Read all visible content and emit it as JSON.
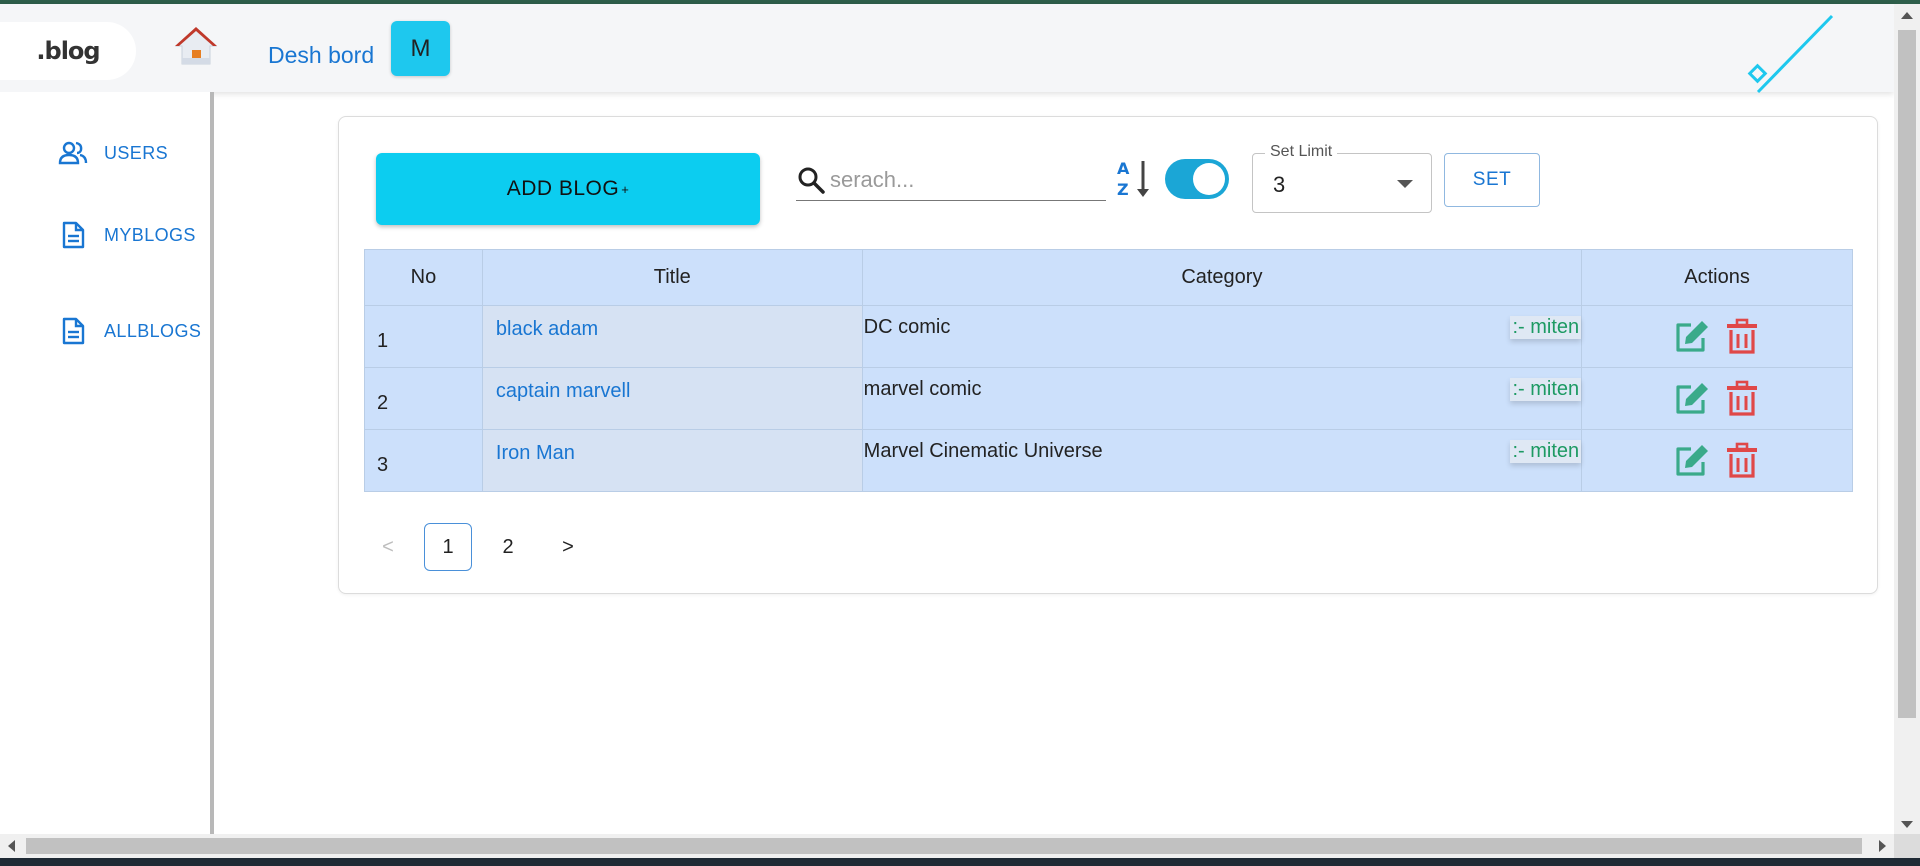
{
  "header": {
    "logo_text": ".blog",
    "dashboard_label": "Desh bord",
    "avatar_initial": "M"
  },
  "sidebar": {
    "items": [
      {
        "label": "USERS",
        "icon": "users-icon"
      },
      {
        "label": "MYBLOGS",
        "icon": "document-icon"
      },
      {
        "label": "ALLBLOGS",
        "icon": "document-icon"
      }
    ]
  },
  "toolbar": {
    "add_label": "ADD BLOG",
    "add_sup": "+",
    "search_placeholder": "serach...",
    "sort_icon": "sort-az-icon",
    "toggle_on": true,
    "limit_label": "Set Limit",
    "limit_value": "3",
    "set_label": "SET"
  },
  "table": {
    "headers": [
      "No",
      "Title",
      "Category",
      "Actions"
    ],
    "rows": [
      {
        "no": "1",
        "title": "black adam",
        "category": "DC comic",
        "author": ":- miten"
      },
      {
        "no": "2",
        "title": "captain marvell",
        "category": "marvel comic",
        "author": ":- miten"
      },
      {
        "no": "3",
        "title": "Iron Man",
        "category": "Marvel Cinematic Universe",
        "author": ":- miten"
      }
    ]
  },
  "pagination": {
    "prev": "<",
    "pages": [
      "1",
      "2"
    ],
    "current": "1",
    "next": ">"
  },
  "colors": {
    "accent": "#0ccdf0",
    "link": "#1976d2",
    "table_bg": "#cce0fb",
    "edit": "#3aaa8a",
    "delete": "#e04848",
    "author": "#1d9a63"
  }
}
